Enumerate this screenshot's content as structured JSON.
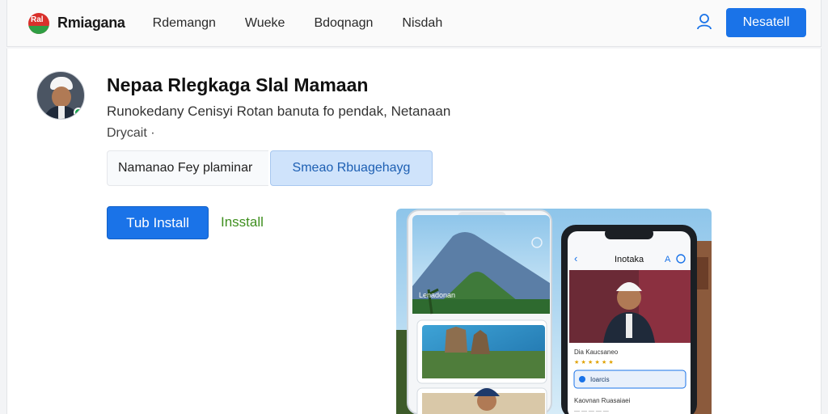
{
  "header": {
    "brand_icon": "flag-logo",
    "brand_glyph": "Ral",
    "brand_name": "Rmiagana",
    "nav": [
      "Rdemangn",
      "Wueke",
      "Bdoqnagn",
      "Nisdah"
    ],
    "user_icon": "user-icon",
    "install_label": "Nesatell"
  },
  "app": {
    "title": "Nepaa Rlegkaga Slal Mamaan",
    "description": "Runokedany Cenisyi Rotan banuta fo pendak, Netanaan",
    "developer": "Drycait ·",
    "search_placeholder": "Namanao Fey plaminar",
    "search_value": "Namanao Fey plaminar",
    "search_button": "Smeao Rbuagehayg",
    "primary_install": "Tub Install",
    "secondary_install": "Insstall",
    "accent_color": "#1a73e8"
  },
  "screenshots": {
    "tablet": {
      "caption": "Lenadonan",
      "cards": [
        "landscape-volcano",
        "temple",
        "portrait-officer"
      ]
    },
    "phone": {
      "back_icon": "chevron-left-icon",
      "screen_title": "Inotaka",
      "text_size_icon": "text-size-icon",
      "info_icon": "info-icon",
      "subtitle": "Dia Kaucsaneo",
      "rating": "★ ★ ★ ★ ★ ★",
      "field_label": "Ioarcis",
      "footer_title": "Kaovnan Ruasaiaei",
      "footer_sub": "— — — — —"
    }
  }
}
